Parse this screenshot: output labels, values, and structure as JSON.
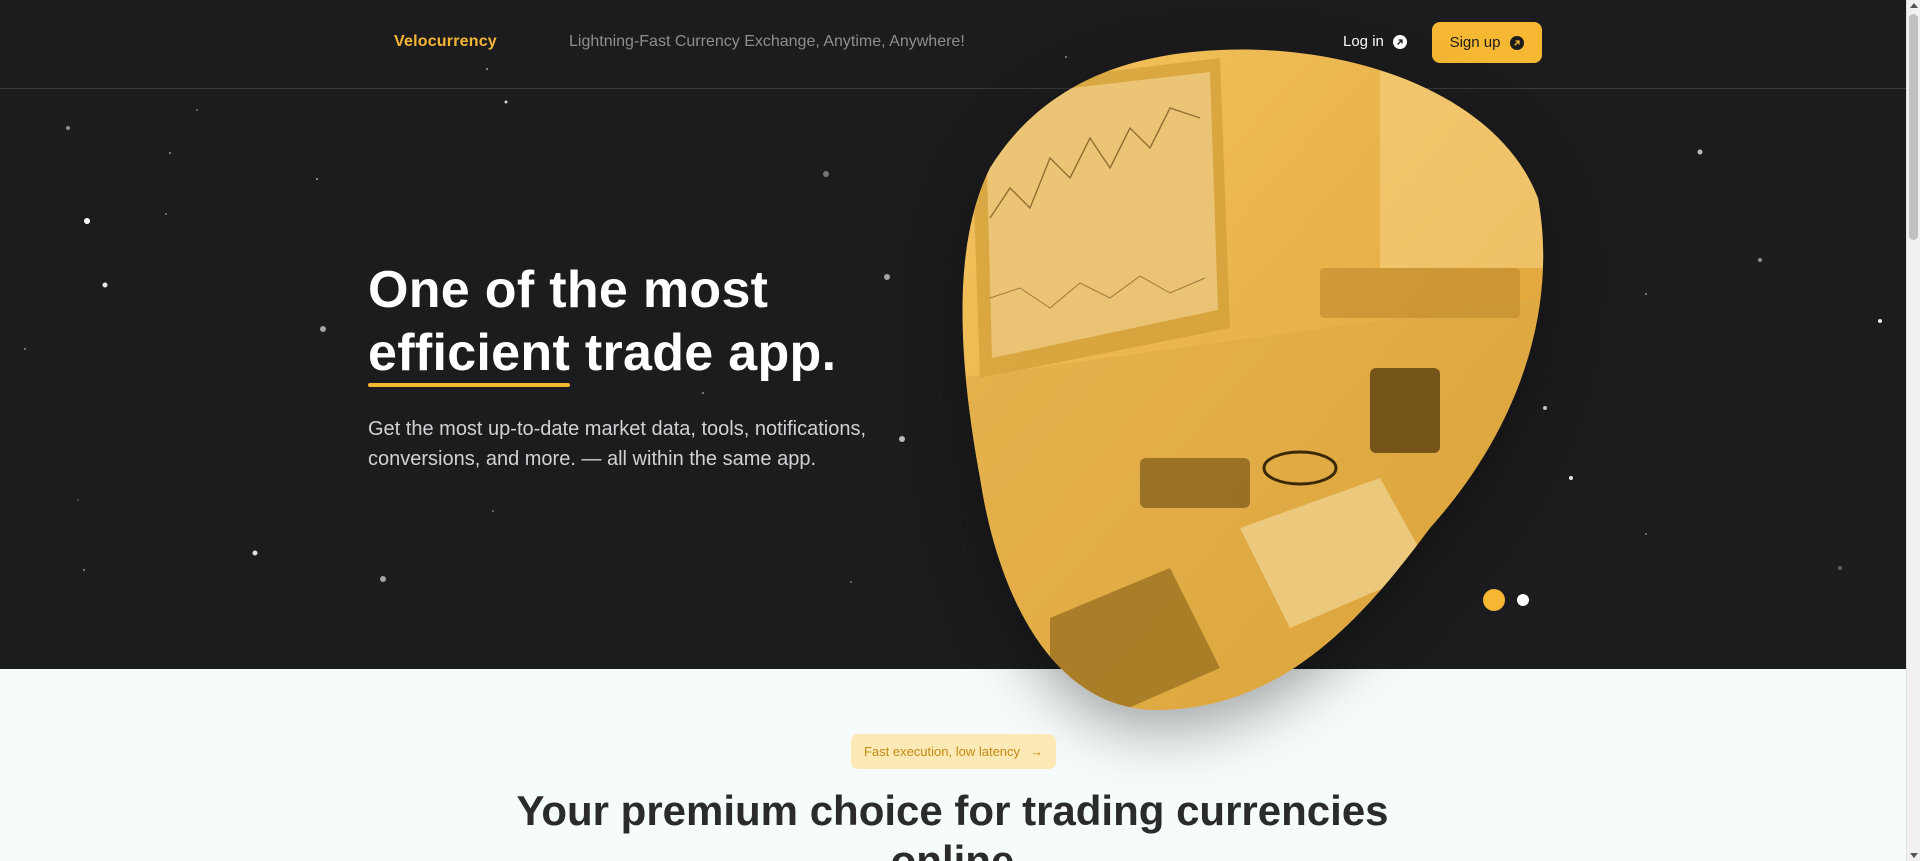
{
  "header": {
    "brand": "Velocurrency",
    "tagline": "Lightning-Fast Currency Exchange, Anytime, Anywhere!",
    "login_label": "Log in",
    "login_icon": "arrow-up-right-circle-icon",
    "signup_label": "Sign up",
    "signup_icon": "arrow-up-right-circle-icon"
  },
  "hero": {
    "title_part1": "One of the most",
    "title_highlight": "efficient",
    "title_part2": "trade app.",
    "subtitle": "Get the most up-to-date market data, tools, notifications, conversions, and more. — all within the same app.",
    "image_subject": "trading desk with chart monitor, calculator, glasses, mug",
    "carousel": {
      "slides": 2,
      "active_index": 0
    }
  },
  "features": {
    "pill_label": "Fast execution, low latency",
    "pill_icon": "arrow-right-icon",
    "title": "Your premium choice for trading currencies online"
  },
  "colors": {
    "accent": "#f6b733",
    "dark_bg": "#1c1c1e",
    "light_bg": "#f6fcfc",
    "pill_bg": "#fde9b6"
  }
}
